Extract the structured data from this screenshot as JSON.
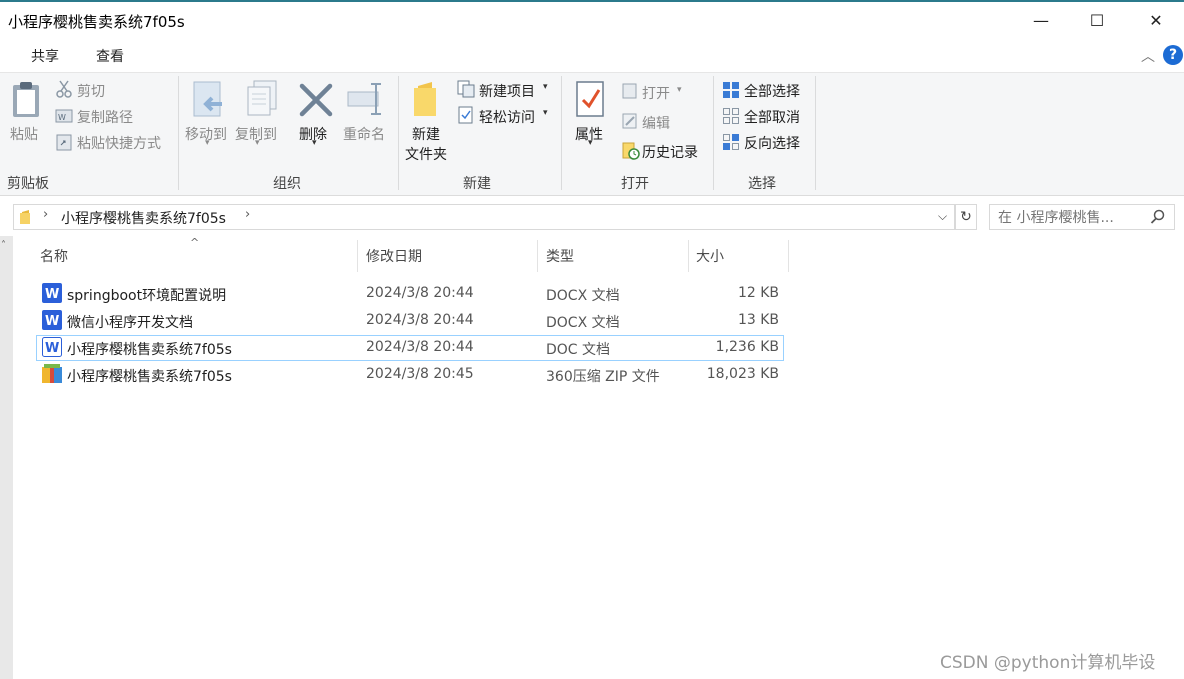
{
  "window": {
    "title": "小程序樱桃售卖系统7f05s"
  },
  "controls": {
    "minimize": "—",
    "maximize": "☐",
    "close": "✕"
  },
  "tabs": [
    {
      "label": "共享"
    },
    {
      "label": "查看"
    }
  ],
  "ribbon": {
    "clipboard": {
      "paste": "粘贴",
      "cut": "剪切",
      "copy_path": "复制路径",
      "paste_shortcut": "粘贴快捷方式",
      "label": "剪贴板"
    },
    "organize": {
      "move_to": "移动到",
      "copy_to": "复制到",
      "delete": "删除",
      "rename": "重命名",
      "label": "组织"
    },
    "new": {
      "new_folder_line1": "新建",
      "new_folder_line2": "文件夹",
      "new_item": "新建项目",
      "easy_access": "轻松访问",
      "label": "新建"
    },
    "open": {
      "properties": "属性",
      "open": "打开",
      "edit": "编辑",
      "history": "历史记录",
      "label": "打开"
    },
    "select": {
      "select_all": "全部选择",
      "select_none": "全部取消",
      "invert": "反向选择",
      "label": "选择"
    }
  },
  "address": {
    "path": "小程序樱桃售卖系统7f05s"
  },
  "search": {
    "placeholder": "在 小程序樱桃售..."
  },
  "columns": {
    "name": "名称",
    "modified": "修改日期",
    "type": "类型",
    "size": "大小"
  },
  "files": [
    {
      "name": "springboot环境配置说明",
      "modified": "2024/3/8 20:44",
      "type": "DOCX 文档",
      "size": "12 KB"
    },
    {
      "name": "微信小程序开发文档",
      "modified": "2024/3/8 20:44",
      "type": "DOCX 文档",
      "size": "13 KB"
    },
    {
      "name": "小程序樱桃售卖系统7f05s",
      "modified": "2024/3/8 20:44",
      "type": "DOC 文档",
      "size": "1,236 KB"
    },
    {
      "name": "小程序樱桃售卖系统7f05s",
      "modified": "2024/3/8 20:45",
      "type": "360压缩 ZIP 文件",
      "size": "18,023 KB"
    }
  ],
  "watermark": "CSDN @python计算机毕设"
}
